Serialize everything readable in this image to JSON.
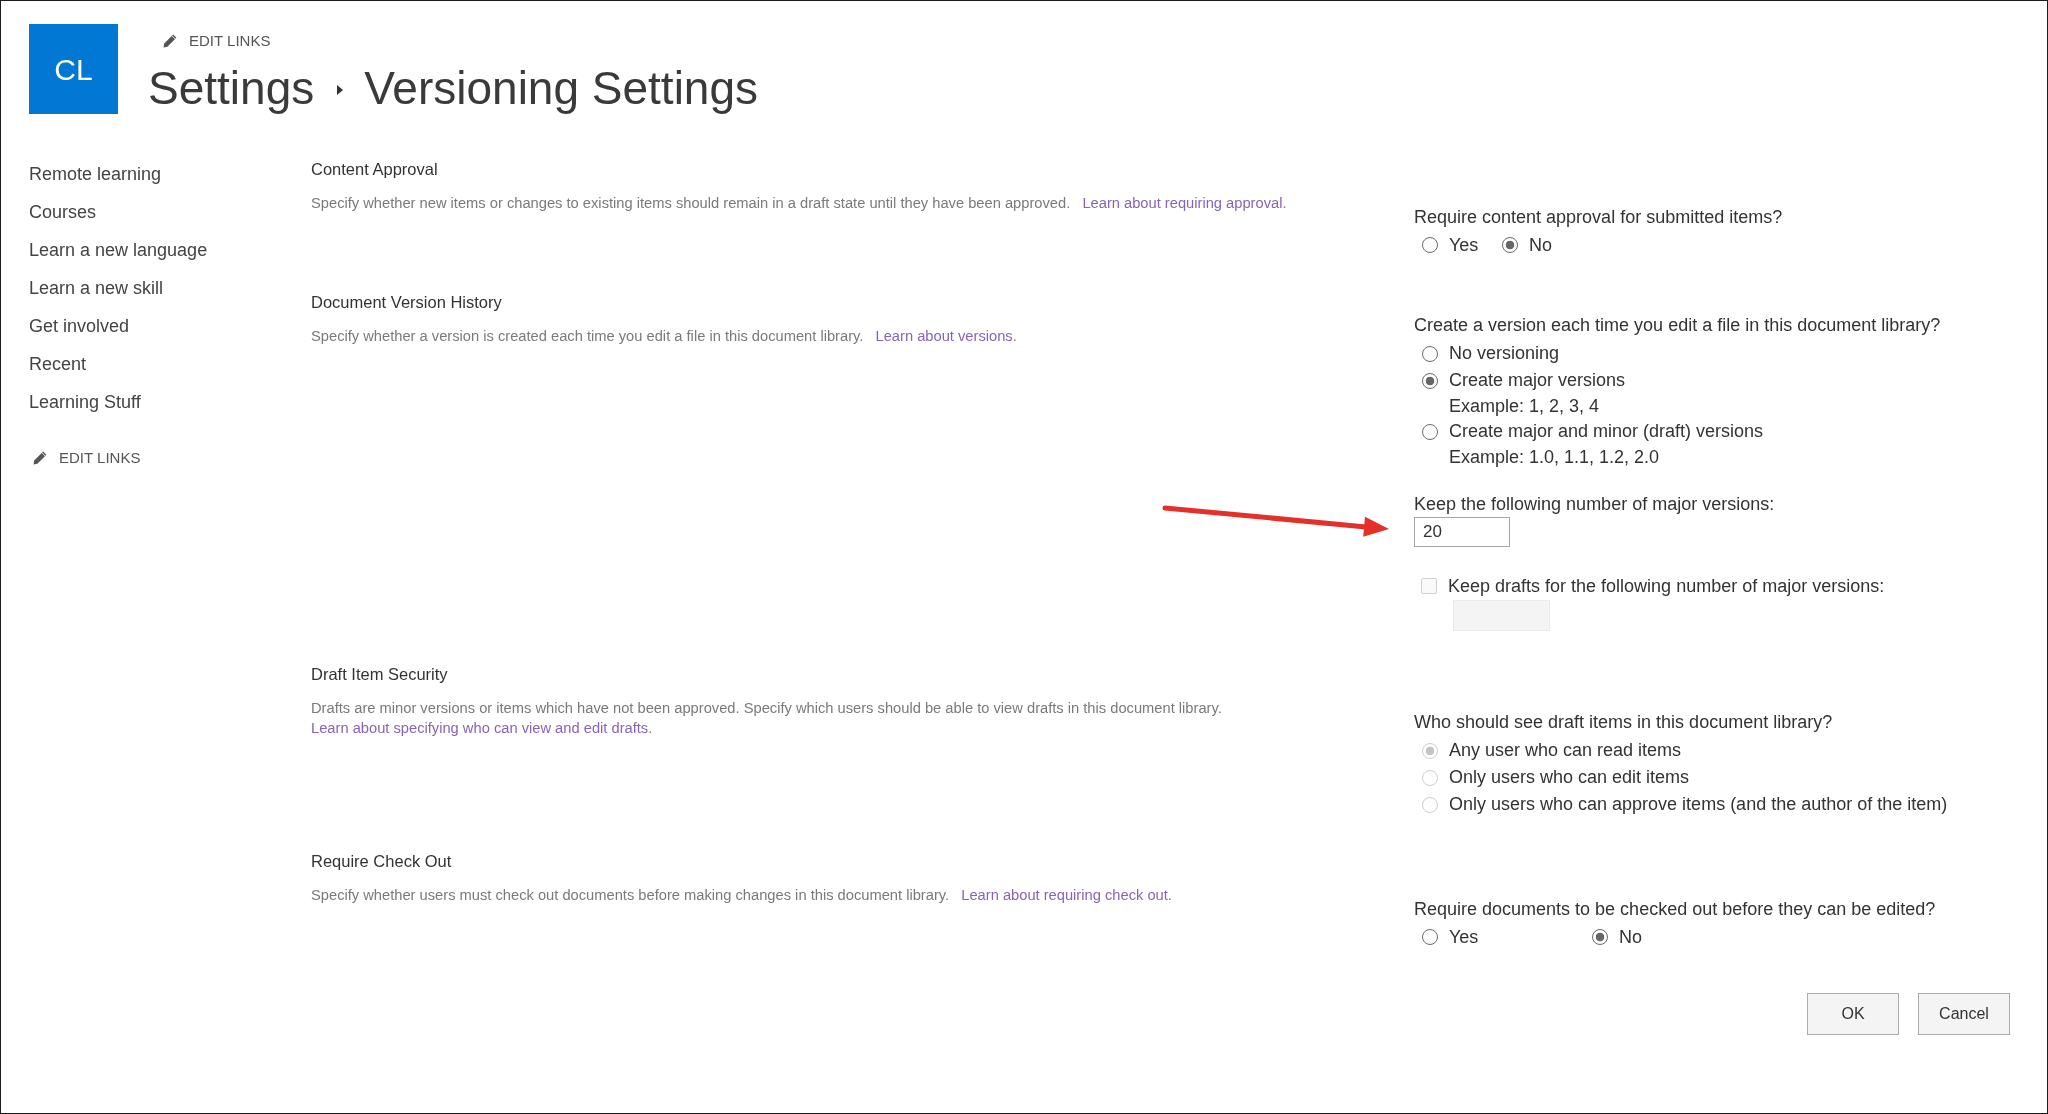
{
  "site": {
    "logo_initials": "CL",
    "edit_links": "EDIT LINKS"
  },
  "breadcrumb": [
    {
      "label": "Settings"
    },
    {
      "label": "Versioning Settings"
    }
  ],
  "sidebar": {
    "items": [
      "Remote learning",
      "Courses",
      "Learn a new language",
      "Learn a new skill",
      "Get involved",
      "Recent",
      "Learning Stuff"
    ],
    "edit_links": "EDIT LINKS"
  },
  "sections": [
    {
      "title": "Content Approval",
      "description": "Specify whether new items or changes to existing items should remain in a draft state until they have been approved.",
      "link": "Learn about requiring approval.",
      "controls": [
        {
          "kind": "radio_row",
          "question": "Require content approval for submitted items?",
          "disabled": false,
          "options": [
            {
              "label": "Yes",
              "selected": false
            },
            {
              "label": "No",
              "selected": true
            }
          ]
        }
      ]
    },
    {
      "title": "Document Version History",
      "description": "Specify whether a version is created each time you edit a file in this document library.",
      "link": "Learn about versions.",
      "controls": [
        {
          "kind": "radio_list",
          "question": "Create a version each time you edit a file in this document library?",
          "disabled": false,
          "options": [
            {
              "label": "No versioning",
              "selected": false
            },
            {
              "label": "Create major versions",
              "selected": true,
              "example": "Example: 1, 2, 3, 4"
            },
            {
              "label": "Create major and minor (draft) versions",
              "selected": false,
              "example": "Example: 1.0, 1.1, 1.2, 2.0"
            }
          ]
        },
        {
          "kind": "number_field",
          "label": "Keep the following number of major versions:",
          "value": "20",
          "marked_by_arrow": true
        },
        {
          "kind": "checkbox_field",
          "label": "Keep drafts for the following number of major versions:",
          "checked": false,
          "disabled": true
        }
      ]
    },
    {
      "title": "Draft Item Security",
      "description": "Drafts are minor versions or items which have not been approved. Specify which users should be able to view drafts in this document library.",
      "link": "Learn about specifying who can view and edit drafts.",
      "controls": [
        {
          "kind": "radio_list",
          "question": "Who should see draft items in this document library?",
          "disabled": true,
          "options": [
            {
              "label": "Any user who can read items",
              "selected": true
            },
            {
              "label": "Only users who can edit items",
              "selected": false
            },
            {
              "label": "Only users who can approve items (and the author of the item)",
              "selected": false
            }
          ]
        }
      ]
    },
    {
      "title": "Require Check Out",
      "description": "Specify whether users must check out documents before making changes in this document library.",
      "link": "Learn about requiring check out.",
      "controls": [
        {
          "kind": "radio_row",
          "question": "Require documents to be checked out before they can be edited?",
          "disabled": false,
          "options": [
            {
              "label": "Yes",
              "selected": false
            },
            {
              "label": "No",
              "selected": true
            }
          ]
        }
      ]
    }
  ],
  "buttons": [
    "OK",
    "Cancel"
  ]
}
